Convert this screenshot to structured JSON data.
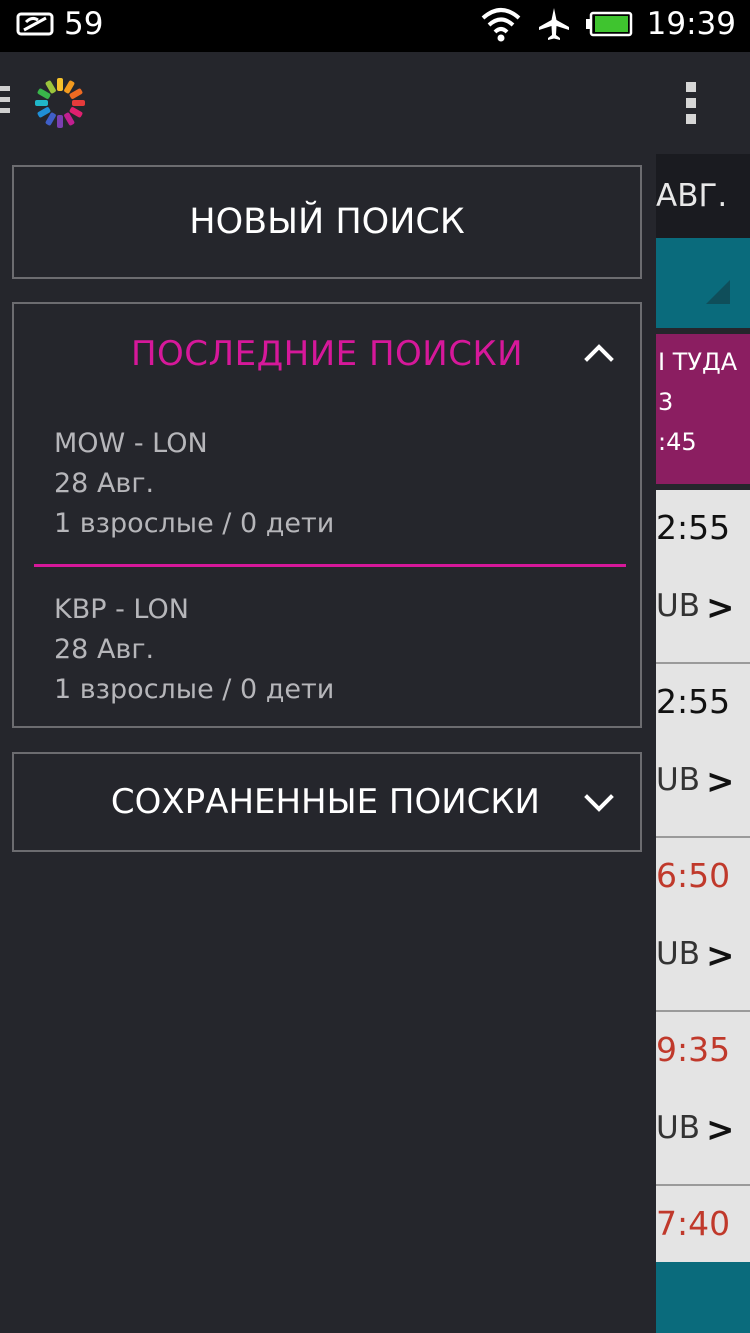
{
  "status_bar": {
    "left_value": "59",
    "time": "19:39",
    "icons": [
      "battery-saver-icon",
      "wifi-icon",
      "airplane-icon",
      "battery-icon"
    ]
  },
  "action_bar": {
    "icons": [
      "hamburger-menu-icon",
      "app-logo-icon",
      "overflow-menu-icon"
    ]
  },
  "drawer": {
    "new_search_label": "НОВЫЙ ПОИСК",
    "recent": {
      "title": "ПОСЛЕДНИЕ ПОИСКИ",
      "expanded": true,
      "items": [
        {
          "route": "MOW - LON",
          "date": "28 Авг.",
          "passengers": "1 взрослые / 0 дети"
        },
        {
          "route": "KBP - LON",
          "date": "28 Авг.",
          "passengers": "1 взрослые / 0 дети"
        }
      ]
    },
    "saved": {
      "title": "СОХРАНЕННЫЕ ПОИСКИ",
      "expanded": false
    }
  },
  "background": {
    "date_fragment": "АВГ.",
    "header_fragment_1": "I ТУДА",
    "header_fragment_2": "3",
    "header_fragment_3": ":45",
    "rows": [
      {
        "time": "2:55",
        "price": "UB",
        "red": false
      },
      {
        "time": "2:55",
        "price": "UB",
        "red": false
      },
      {
        "time": "6:50",
        "price": "UB",
        "red": true
      },
      {
        "time": "9:35",
        "price": "UB",
        "red": true
      },
      {
        "time": "7:40",
        "price": "",
        "red": true
      }
    ]
  },
  "colors": {
    "accent": "#d6189a",
    "drawer_bg": "#25262c",
    "border": "#6c6c70",
    "teal": "#0a6b7c",
    "magenta_bg": "#8b1e61"
  }
}
